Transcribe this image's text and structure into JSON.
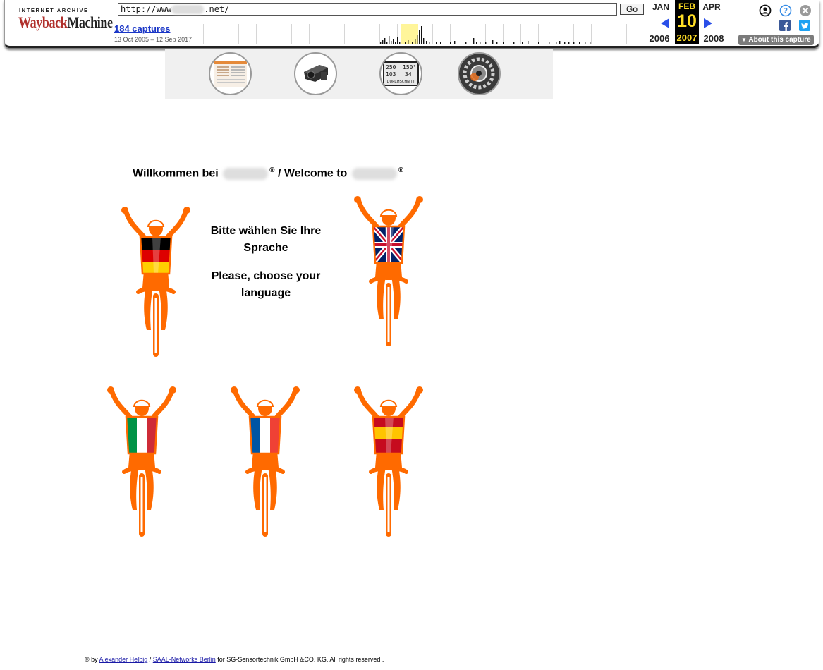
{
  "toolbar": {
    "ia_label": "INTERNET ARCHIVE",
    "logo_wayback": "Wayback",
    "logo_machine": "Machine",
    "url_prefix": "http://www",
    "url_suffix": ".net/",
    "go_label": "Go",
    "captures_label": "184 captures",
    "captures_range": "13 Oct 2005 – 12 Sep 2017",
    "prev_month": "JAN",
    "current_month": "FEB",
    "next_month": "APR",
    "current_day": "10",
    "prev_year": "2006",
    "current_year": "2007",
    "next_year": "2008",
    "about_label": "About this capture",
    "colors": {
      "logo_red": "#b0302c",
      "link_blue": "#1a36c7",
      "arrow_blue": "#2a4fe8",
      "highlight_yellow": "#ffde25",
      "facebook": "#3b5998",
      "twitter": "#1da1f2"
    }
  },
  "page": {
    "welcome_prefix": "Willkommen bei",
    "welcome_reg1": "®",
    "welcome_middle": "/ Welcome to",
    "welcome_reg2": "®",
    "choose_de": "Bitte wählen Sie Ihre Sprache",
    "choose_en": "Please, choose your language",
    "nav_thumbnails": [
      "document-thumbnail",
      "bike-mount-thumbnail",
      "display-readout-thumbnail",
      "gear-thumbnail"
    ],
    "display_readout": {
      "v1": "250",
      "v2": "150°",
      "v3": "103",
      "v4": "34",
      "label": "DURCHSCHNITT"
    },
    "languages": [
      {
        "name": "german-flag-rider",
        "colors": [
          "#000000",
          "#dd0000",
          "#ffce00"
        ]
      },
      {
        "name": "uk-flag-rider",
        "colors": [
          "#012169",
          "#ffffff",
          "#c8102e"
        ]
      },
      {
        "name": "italian-flag-rider",
        "colors": [
          "#009246",
          "#ffffff",
          "#ce2b37"
        ]
      },
      {
        "name": "french-flag-rider",
        "colors": [
          "#0055a4",
          "#ffffff",
          "#ef4135"
        ]
      },
      {
        "name": "spanish-flag-rider",
        "colors": [
          "#c60b1e",
          "#ffc400",
          "#c60b1e"
        ]
      }
    ],
    "rider_color": "#ff6a00"
  },
  "footer": {
    "copyright_prefix": "© by",
    "author_link": "Alexander Helbig",
    "separator": "/",
    "agency_link": "SAAL-Networks Berlin",
    "suffix": "for SG-Sensortechnik GmbH &CO. KG. All rights reserved ."
  }
}
